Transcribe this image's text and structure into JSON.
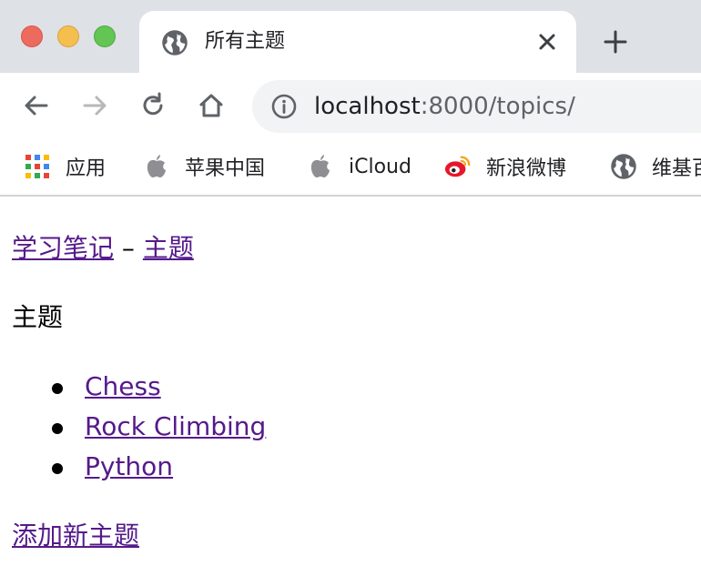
{
  "tab": {
    "title": "所有主题",
    "favicon": "globe-icon"
  },
  "toolbar": {
    "url_host": "localhost",
    "url_rest": ":8000/topics/"
  },
  "bookmarks": [
    {
      "label": "应用",
      "icon": "apps-grid-icon"
    },
    {
      "label": "苹果中国",
      "icon": "apple-icon"
    },
    {
      "label": "iCloud",
      "icon": "apple-icon"
    },
    {
      "label": "新浪微博",
      "icon": "weibo-icon"
    },
    {
      "label": "维基百",
      "icon": "globe-icon"
    }
  ],
  "page": {
    "site_link": "学习笔记",
    "separator": "–",
    "topics_link": "主题",
    "heading": "主题",
    "topics": [
      "Chess",
      "Rock Climbing",
      "Python"
    ],
    "add_link": "添加新主题"
  },
  "colors": {
    "link": "#551a8b",
    "tabstrip": "#dee1e6",
    "omnibox": "#f1f3f4"
  }
}
